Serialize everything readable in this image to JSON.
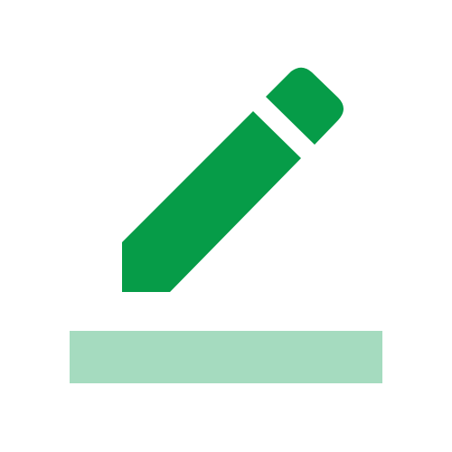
{
  "icon": {
    "name": "edit-pencil-icon",
    "colors": {
      "pencil": "#069C48",
      "underline": "#A5DBBF",
      "background": "#FFFFFF"
    }
  }
}
